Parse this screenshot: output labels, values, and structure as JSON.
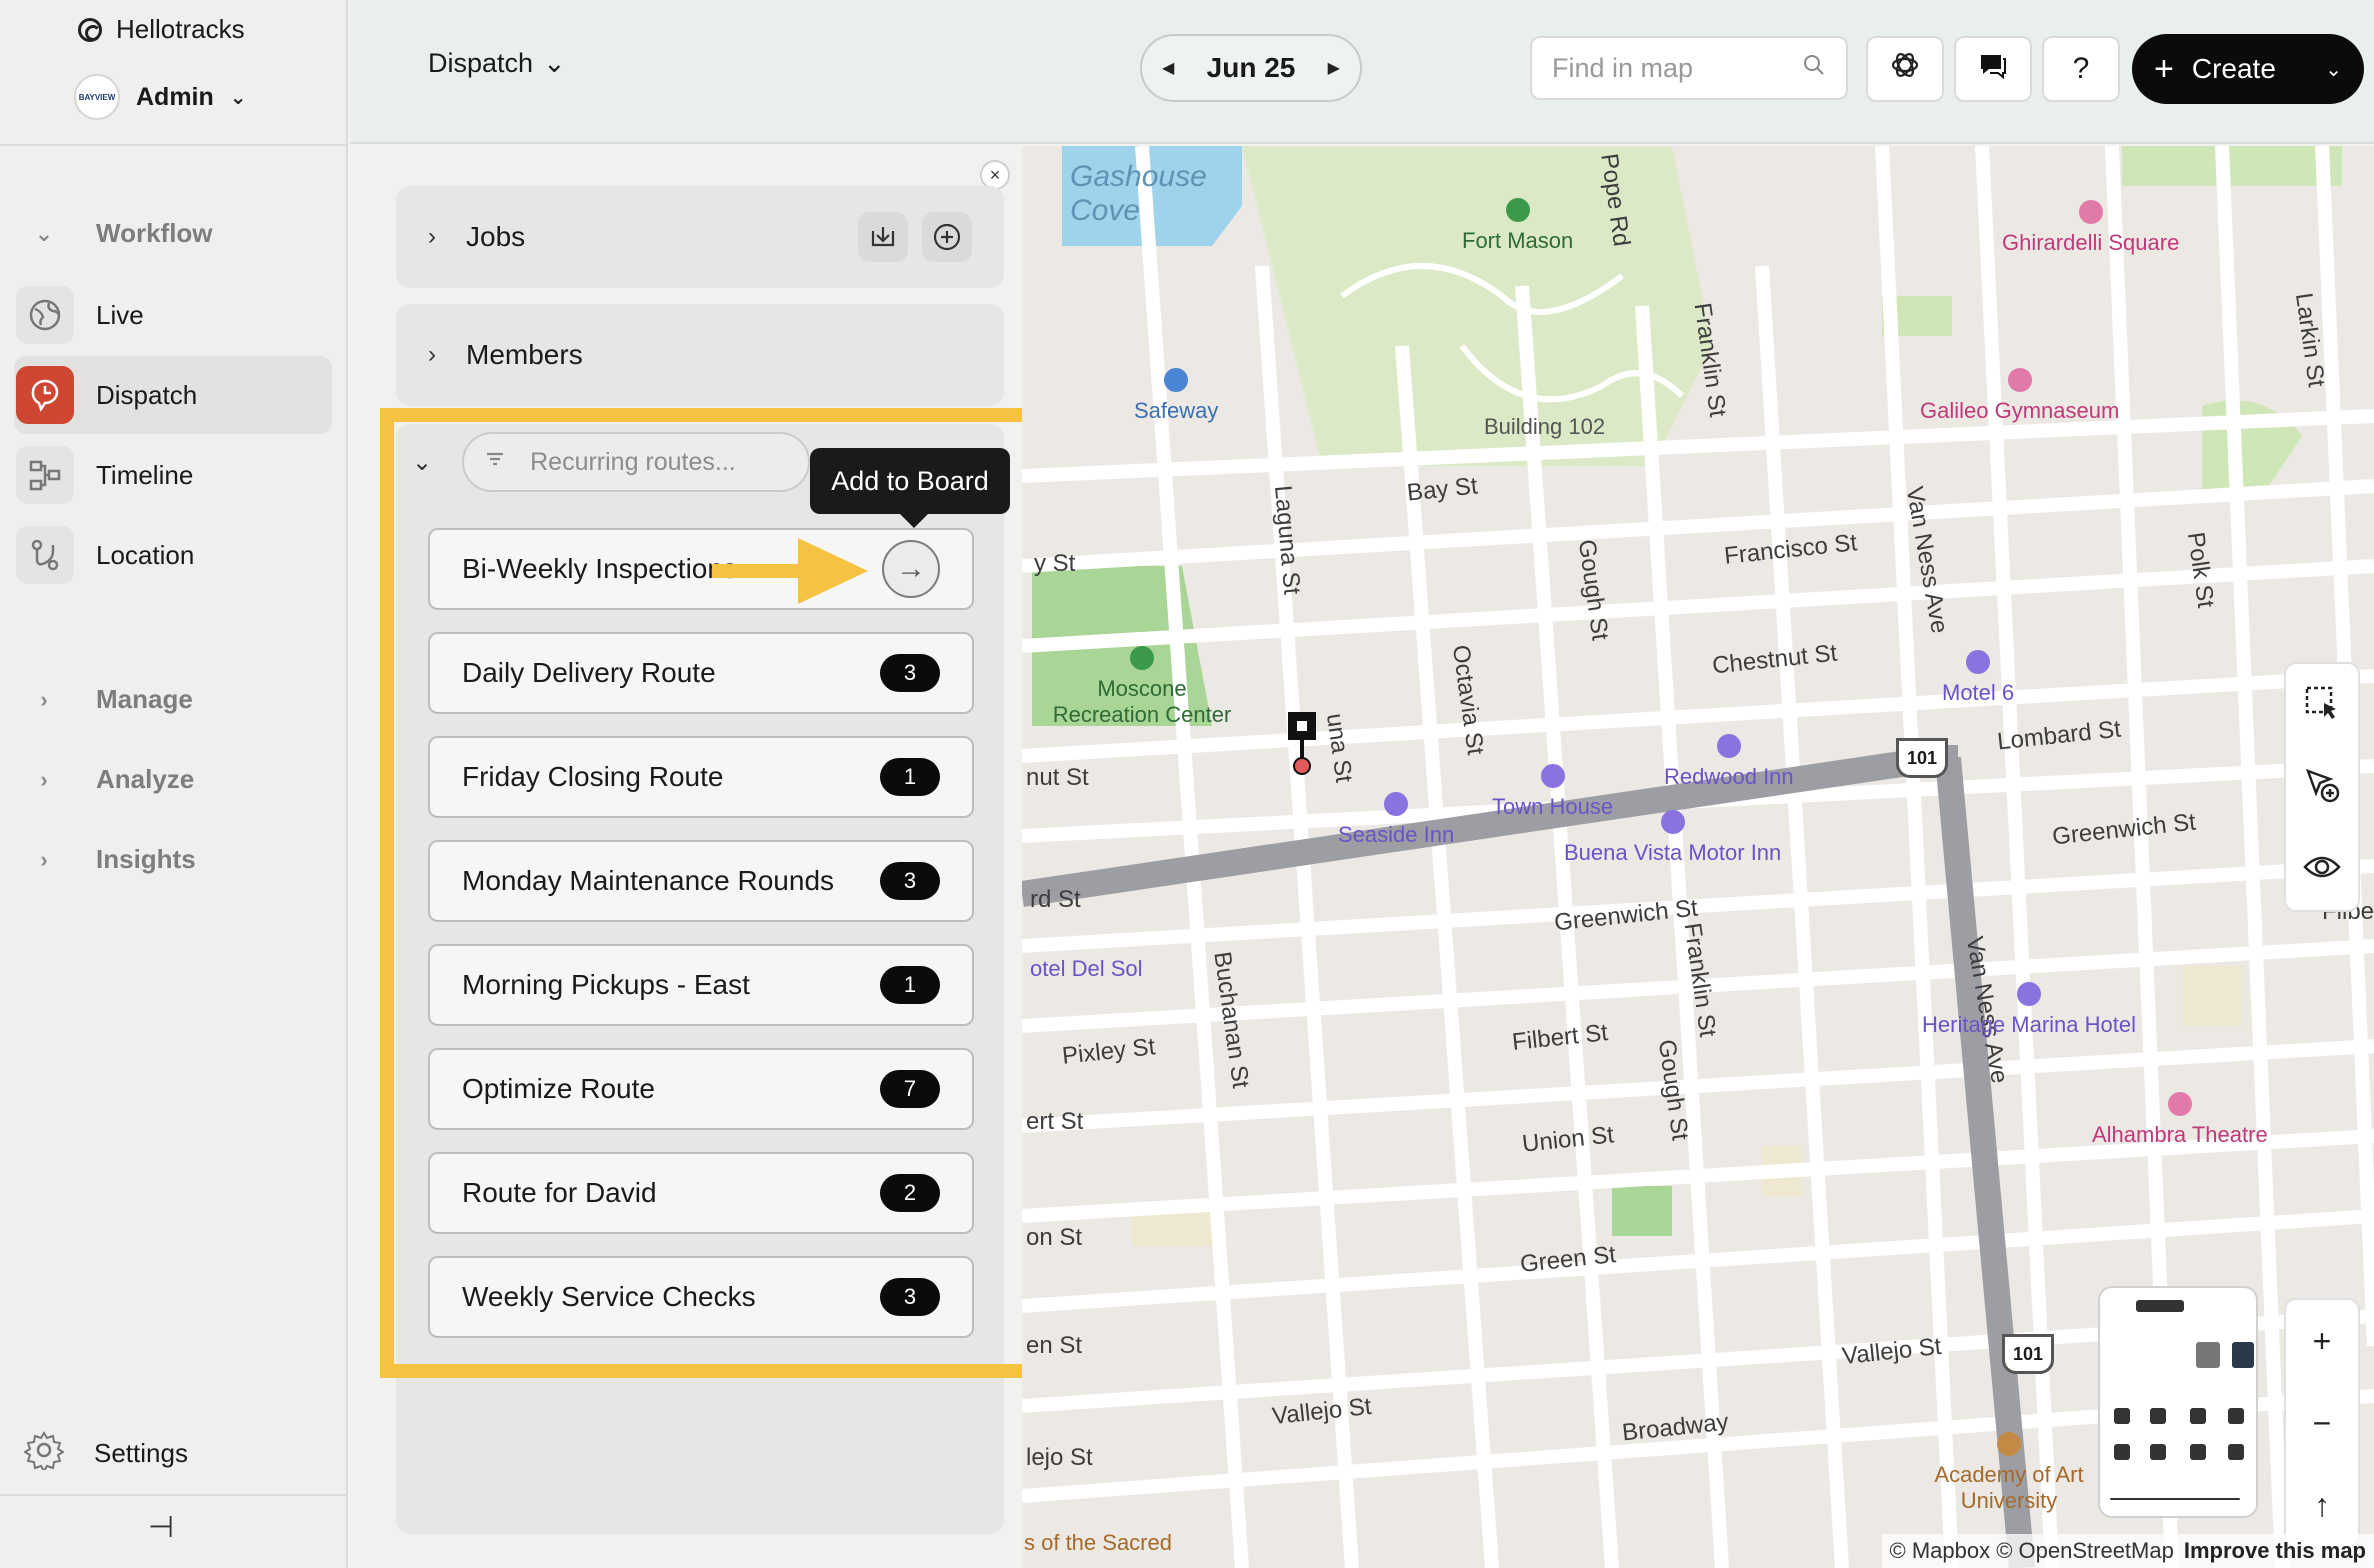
{
  "app": {
    "name": "Hellotracks",
    "account_name": "Admin",
    "account_logo_text": "BAYVIEW"
  },
  "sidebar": {
    "workflow_label": "Workflow",
    "items": [
      {
        "label": "Live",
        "icon": "globe-icon"
      },
      {
        "label": "Dispatch",
        "icon": "dispatch-icon",
        "active": true
      },
      {
        "label": "Timeline",
        "icon": "timeline-icon"
      },
      {
        "label": "Location",
        "icon": "location-route-icon"
      }
    ],
    "groups": [
      {
        "label": "Manage"
      },
      {
        "label": "Analyze"
      },
      {
        "label": "Insights"
      }
    ],
    "settings_label": "Settings"
  },
  "topbar": {
    "view_selector": "Dispatch",
    "date": "Jun 25",
    "search_placeholder": "Find in map",
    "help_label": "?",
    "create_label": "Create"
  },
  "panel": {
    "jobs_label": "Jobs",
    "members_label": "Members",
    "routes_filter_placeholder": "Recurring routes...",
    "tooltip": "Add to Board",
    "routes": [
      {
        "name": "Bi-Weekly Inspections",
        "count": null
      },
      {
        "name": "Daily Delivery Route",
        "count": "3"
      },
      {
        "name": "Friday Closing Route",
        "count": "1"
      },
      {
        "name": "Monday Maintenance Rounds",
        "count": "3"
      },
      {
        "name": "Morning Pickups - East",
        "count": "1"
      },
      {
        "name": "Optimize Route",
        "count": "7"
      },
      {
        "name": "Route for David",
        "count": "2"
      },
      {
        "name": "Weekly Service Checks",
        "count": "3"
      }
    ]
  },
  "map": {
    "streets": [
      "Laguna St",
      "Bay St",
      "Francisco St",
      "Chestnut St",
      "Lombard St",
      "Greenwich St",
      "Filbert St",
      "Union St",
      "Green St",
      "Vallejo St",
      "Broadway",
      "Pixley St",
      "Buchanan St",
      "Octavia St",
      "Gough St",
      "Franklin St",
      "Van Ness Ave",
      "Polk St",
      "Larkin St",
      "Pope Rd",
      "Franklin St",
      "Gough St",
      "Van Ness Ave",
      "Greenwich St",
      "Vallejo St"
    ],
    "places": {
      "fort_mason": "Fort Mason",
      "safeway": "Safeway",
      "building_102": "Building 102",
      "ghirardelli": "Ghirardelli Square",
      "galileo": "Galileo Gymnaseum",
      "moscone": "Moscone Recreation Center",
      "motel6": "Motel 6",
      "redwood": "Redwood Inn",
      "town_house": "Town House",
      "seaside": "Seaside Inn",
      "buena_vista": "Buena Vista Motor Inn",
      "heritage": "Heritage Marina Hotel",
      "alhambra": "Alhambra Theatre",
      "hotel_del_sol": "otel Del Sol",
      "academy": "Academy of Art University",
      "sacred": "s of the Sacred",
      "gashouse": "Gashouse Cove"
    },
    "highway_number": "101",
    "attribution": "© Mapbox © OpenStreetMap",
    "improve_label": "Improve this map",
    "partial_labels": {
      "west_y_st": "y St",
      "west_nut_st": "nut St",
      "west_rd_st": "rd St",
      "west_ert_st": "ert St",
      "west_on_st": "on St",
      "west_en_st": "en St",
      "west_lejo_st": "lejo St",
      "east_filbe": "Filbe",
      "una_st": "una St"
    }
  },
  "colors": {
    "accent_dispatch": "#cf4633",
    "highlight_yellow": "#f5c242",
    "create_button": "#0b0b0b"
  }
}
